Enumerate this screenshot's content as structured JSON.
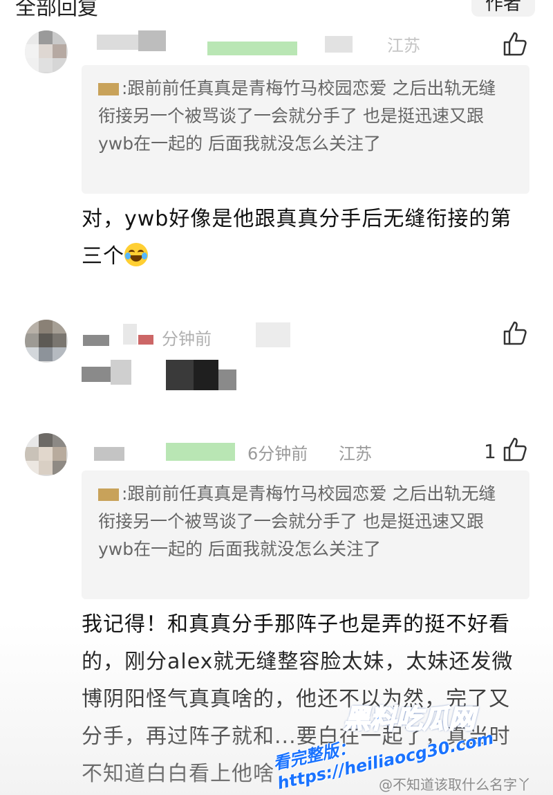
{
  "header": {
    "title": "全部回复",
    "author_button": "作者"
  },
  "comments": [
    {
      "meta_location": "江苏",
      "quote_text": ":跟前前任真真是青梅竹马校园恋爱 之后出轨无缝衔接另一个被骂谈了一会就分手了 也是挺迅速又跟ywb在一起的 后面我就没怎么关注了",
      "body_text": "对，ywb好像是他跟真真分手后无缝衔接的第三个",
      "emoji": "laughing-tears-emoji"
    },
    {
      "meta_time": "分钟前"
    },
    {
      "meta_time": "6分钟前",
      "meta_location": "江苏",
      "like_count": "1",
      "quote_text": ":跟前前任真真是青梅竹马校园恋爱 之后出轨无缝衔接另一个被骂谈了一会就分手了 也是挺迅速又跟ywb在一起的 后面我就没怎么关注了",
      "body_text": "我记得！和真真分手那阵子也是弄的挺不好看的，刚分alex就无缝整容脸太妹，太妹还发微博阴阳怪气真真啥的，他还不以为然，完了又分手，再过阵子就和...要白在一起了，真当时不知道白白看上他啥"
    }
  ],
  "watermark": {
    "brand": "黑料吃瓜网",
    "url": "看完整版：https://heiliaocg30.com",
    "weibo": "@不知道该取什么名字丫"
  },
  "colors": {
    "quote_bg": "#f4f4f4",
    "meta_gray": "#9a9a9a",
    "watermark_blue": "#1a73ff"
  }
}
